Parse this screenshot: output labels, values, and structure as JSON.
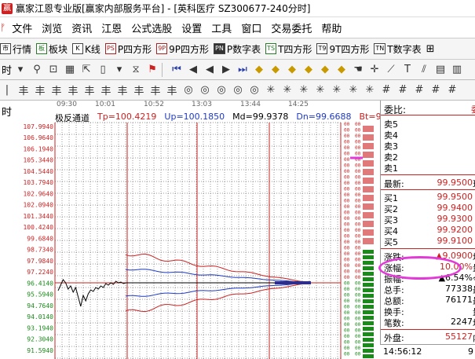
{
  "window": {
    "title": "赢家江恩专业版[赢家内部服务平台] - [英科医疗   SZ300677-240分时]"
  },
  "menu": {
    "items": [
      "文件",
      "浏览",
      "资讯",
      "江恩",
      "公式选股",
      "设置",
      "工具",
      "窗口",
      "交易委托",
      "帮助"
    ]
  },
  "toolbar1": {
    "items": [
      {
        "icon": "市",
        "label": "行情"
      },
      {
        "icon": "板",
        "label": "板块"
      },
      {
        "icon": "K",
        "label": "K线"
      },
      {
        "icon": "PS",
        "label": "P四方形"
      },
      {
        "icon": "9P",
        "label": "9P四方形"
      },
      {
        "icon": "PN",
        "label": "P数字表"
      },
      {
        "icon": "TS",
        "label": "T四方形"
      },
      {
        "icon": "T9",
        "label": "9T四方形"
      },
      {
        "icon": "TN",
        "label": "T数字表"
      }
    ]
  },
  "toolbar2": {
    "lead_label": "时"
  },
  "chart": {
    "axis_left_label": "时",
    "time_labels": [
      "09:30",
      "10:01",
      "10:52",
      "13:03",
      "13:44",
      "14:25"
    ],
    "indicator": {
      "name": "极反通道",
      "tp": "Tp=100.4219",
      "up": "Up=100.1850",
      "md": "Md=99.9378",
      "dn": "Dn=99.6688",
      "bt": "Bt=99.4319"
    },
    "left_scale": [
      "107.9940",
      "106.9640",
      "106.1940",
      "105.3440",
      "104.5440",
      "103.7940",
      "102.9640",
      "102.0940",
      "101.3440",
      "100.4240",
      "99.6840",
      "98.7340",
      "97.9840",
      "97.2240",
      "96.4140",
      "95.5940",
      "94.7640",
      "94.0140",
      "93.1940",
      "92.3040",
      "91.5940"
    ]
  },
  "chart_data": {
    "type": "line",
    "x": [
      "09:30",
      "10:01",
      "10:52",
      "13:03",
      "13:44",
      "14:25"
    ],
    "series": [
      {
        "name": "Tp",
        "values": [
          100.4219
        ]
      },
      {
        "name": "Up",
        "values": [
          100.185
        ]
      },
      {
        "name": "Md",
        "values": [
          99.9378
        ]
      },
      {
        "name": "Dn",
        "values": [
          99.6688
        ]
      },
      {
        "name": "Bt",
        "values": [
          99.4319
        ]
      }
    ]
  },
  "panel": {
    "weibi_label": "委比:",
    "weibi_tail": "委",
    "sell_rows": [
      {
        "label": "卖5"
      },
      {
        "label": "卖4"
      },
      {
        "label": "卖3"
      },
      {
        "label": "卖2"
      },
      {
        "label": "卖1"
      }
    ],
    "latest": {
      "label": "最新:",
      "value": "99.9500",
      "tail": "现"
    },
    "buy_rows": [
      {
        "label": "买1",
        "value": "99.9500"
      },
      {
        "label": "买2",
        "value": "99.9400"
      },
      {
        "label": "买3",
        "value": "99.9300"
      },
      {
        "label": "买4",
        "value": "99.9200"
      },
      {
        "label": "买5",
        "value": "99.9100"
      }
    ],
    "stats": [
      {
        "label": "涨跌:",
        "value": "▲9.0900",
        "tail": "均"
      },
      {
        "label": "涨幅:",
        "value": "10.00%",
        "tail": "量"
      },
      {
        "label": "振幅:",
        "value": "▲6.54%",
        "tail": "今"
      },
      {
        "label": "总手:",
        "value": "77338",
        "tail": "最"
      },
      {
        "label": "总额:",
        "value": "76171",
        "tail": "最"
      },
      {
        "label": "换手:",
        "value": "",
        "tail": "量"
      },
      {
        "label": "笔数:",
        "value": "2247",
        "tail": "均"
      }
    ],
    "outer": {
      "label": "外盘:",
      "value": "55127",
      "tail": "内"
    },
    "status_time": "14:56:12",
    "status_tail": "9"
  },
  "colors": {
    "red": "#cc2222",
    "green": "#1a8a1a",
    "highlight": "#e23ad7",
    "blue": "#1f3ac4"
  }
}
